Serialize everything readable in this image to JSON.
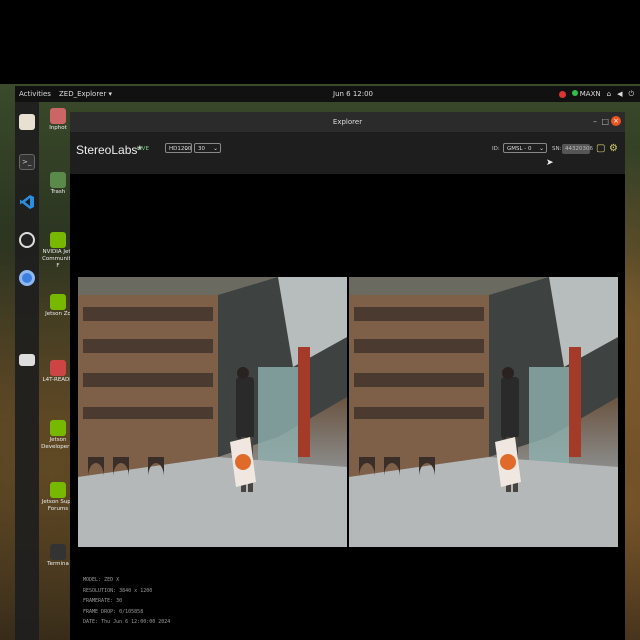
{
  "topbar": {
    "activities": "Activities",
    "app_menu": "ZED_Explorer ▾",
    "clock": "Jun 6 12:00",
    "power_mode": "MAXN",
    "tray_icons": [
      "nvidia-icon",
      "network-icon",
      "volume-icon",
      "power-icon"
    ]
  },
  "dock": {
    "items": [
      "files-icon",
      "terminal-icon",
      "vscode-icon",
      "obs-icon",
      "chromium-icon",
      "drive-icon"
    ]
  },
  "desktop": {
    "items": [
      {
        "label": "Inphot",
        "icon": "folder-icon"
      },
      {
        "label": "Trash",
        "icon": "trash-icon"
      },
      {
        "label": "NVIDIA Jets Community F",
        "icon": "nvidia-icon"
      },
      {
        "label": "Jetson Zo",
        "icon": "nvidia-icon"
      },
      {
        "label": "L4T-READN",
        "icon": "folder-icon"
      },
      {
        "label": "Jetson Developer Z",
        "icon": "nvidia-icon"
      },
      {
        "label": "Jetson Supp Forums",
        "icon": "nvidia-icon"
      },
      {
        "label": "Termina",
        "icon": "terminal-icon"
      }
    ]
  },
  "window": {
    "title": "Explorer",
    "brand": "StereoLabs*",
    "live": "LIVE",
    "resolution_select": "HD1200",
    "fps_select": "30",
    "id_label": "ID:",
    "id_select": "GMSL - 0",
    "sn_label": "SN:",
    "sn_value": "44320306"
  },
  "info": {
    "model": "MODEL: ZED X",
    "resolution": "RESOLUTION: 3840 x 1200",
    "framerate": "FRAMERATE: 30",
    "frame_drop": "FRAME DROP: 0/105858",
    "date": "DATE: Thu Jun 6 12:00:00 2024"
  }
}
